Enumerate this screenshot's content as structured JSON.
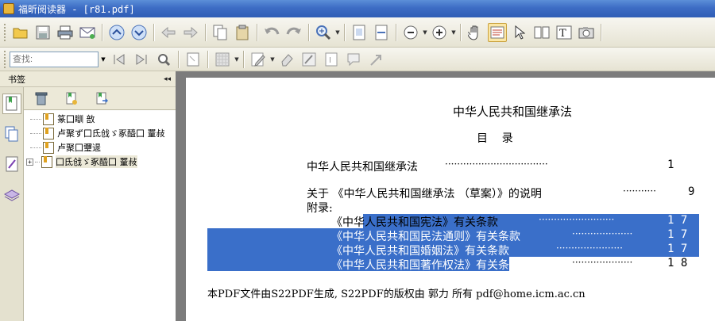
{
  "window": {
    "title": "福昕阅读器 - [r81.pdf]"
  },
  "search": {
    "placeholder": "查找:"
  },
  "sidebar": {
    "header_label": "书签",
    "collapse_glyph": "◂◂",
    "bookmarks": [
      {
        "label": "篆囗瞓  敨",
        "expandable": false
      },
      {
        "label": "卢聚ず囗氐戗ゞ豖醯囗  罿敊",
        "expandable": false
      },
      {
        "label": "卢聚囗瓕遈",
        "expandable": false
      },
      {
        "label": "囗氐戗ゞ豖醯囗  罿敊",
        "expandable": true,
        "selected": true
      }
    ]
  },
  "document": {
    "title": "中华人民共和国继承法",
    "toc_heading": "目    录",
    "entries": [
      {
        "text": "中华人民共和国继承法",
        "dots": "··································",
        "page": "1"
      },
      {
        "text": "关于 《中华人民共和国继承法 （草案）》的说明",
        "dots": "···········",
        "page": "9"
      }
    ],
    "appendix_label": "附录:",
    "appendix_entries": [
      {
        "text": "《中华人民共和国宪法》有关条款",
        "dots": "·························",
        "page": "1 7"
      },
      {
        "text": "《中华人民共和国民法通则》有关条款",
        "dots": "····················",
        "page": "1 7"
      },
      {
        "text": "《中华人民共和国婚姻法》有关条款",
        "dots": "······················",
        "page": "1 7"
      },
      {
        "text": "《中华人民共和国著作权法》有关条款",
        "dots": "····················",
        "page": "1 8"
      }
    ],
    "footer": "本PDF文件由S22PDF生成, S22PDF的版权由 郭力 所有 pdf@home.icm.ac.cn"
  },
  "colors": {
    "titlebar": "#3d6cc4",
    "selection": "#3a6fc9",
    "toolbar": "#ece9d8"
  }
}
